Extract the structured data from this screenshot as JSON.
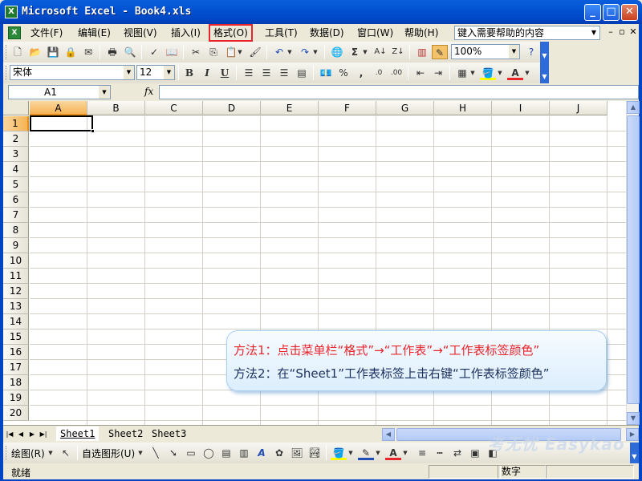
{
  "window": {
    "title": "Microsoft Excel - Book4.xls",
    "app_icon": "excel-icon",
    "controls": [
      "minimize",
      "maximize",
      "close"
    ]
  },
  "menu": {
    "items": [
      "文件(F)",
      "编辑(E)",
      "视图(V)",
      "插入(I)",
      "格式(O)",
      "工具(T)",
      "数据(D)",
      "窗口(W)",
      "帮助(H)"
    ],
    "highlighted": "格式(O)",
    "help_placeholder": "键入需要帮助的内容"
  },
  "standard_toolbar": {
    "zoom": "100%"
  },
  "format_toolbar": {
    "font": "宋体",
    "size": "12",
    "bold": "B",
    "italic": "I",
    "underline": "U",
    "percent": "%",
    "comma": ","
  },
  "formula_bar": {
    "name_box": "A1",
    "fx": "fx",
    "value": ""
  },
  "sheet": {
    "columns": [
      "A",
      "B",
      "C",
      "D",
      "E",
      "F",
      "G",
      "H",
      "I",
      "J"
    ],
    "rows": [
      "1",
      "2",
      "3",
      "4",
      "5",
      "6",
      "7",
      "8",
      "9",
      "10",
      "11",
      "12",
      "13",
      "14",
      "15",
      "16",
      "17",
      "18",
      "19",
      "20"
    ],
    "active_cell": "A1"
  },
  "callout": {
    "line1": "方法1：点击菜单栏“格式”→“工作表”→“工作表标签颜色”",
    "line2": "方法2：在“Sheet1”工作表标签上击右键“工作表标签颜色”"
  },
  "tabs": [
    "Sheet1",
    "Sheet2",
    "Sheet3"
  ],
  "active_tab": "Sheet1",
  "drawing_toolbar": {
    "draw_label": "绘图(R)",
    "autoshape_label": "自选图形(U)"
  },
  "watermark": "考无忧 Easykao",
  "status": {
    "ready": "就绪",
    "num": "数字"
  },
  "colors": {
    "titlebar": "#0353D3",
    "highlight_box": "#E8252A",
    "active_header": "#F5B454",
    "callout_red": "#E8252A",
    "callout_navy": "#1B2F5E"
  }
}
